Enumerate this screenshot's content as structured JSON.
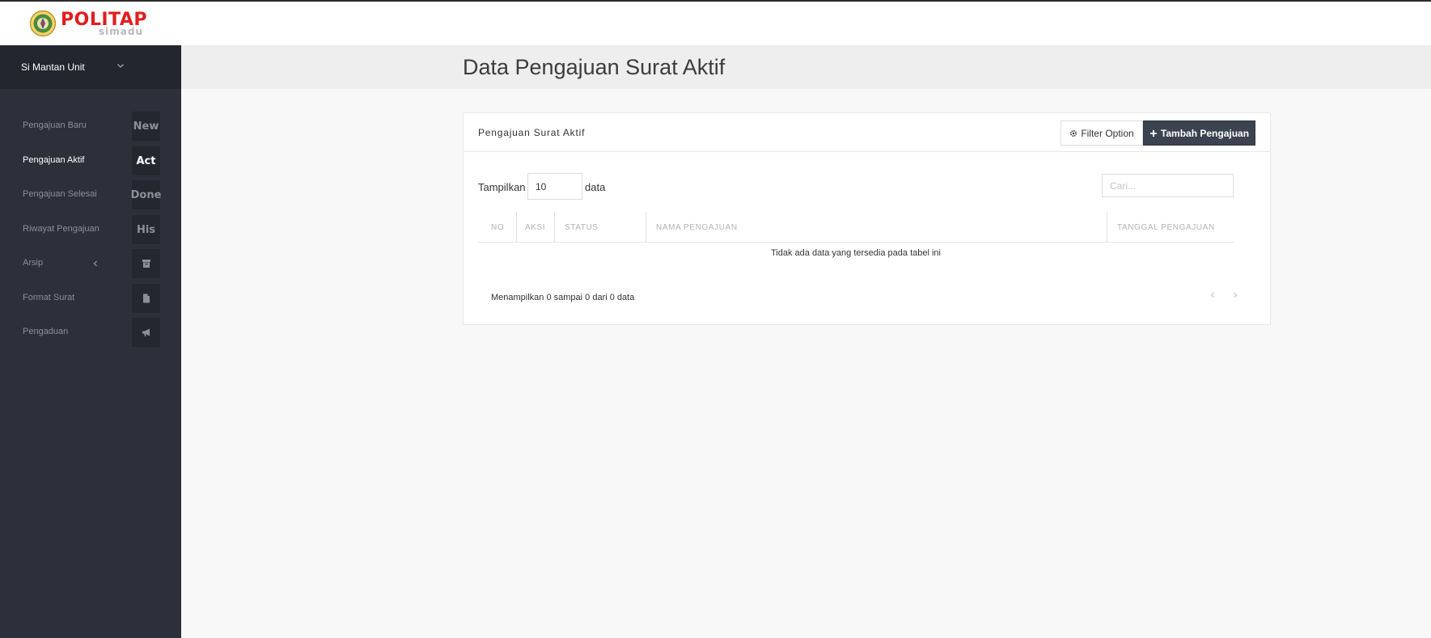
{
  "brand": {
    "name": "POLITAP",
    "sub": "simadu"
  },
  "sidebar": {
    "user": "Si Mantan Unit",
    "items": [
      {
        "label": "Pengajuan Baru",
        "badge": "New",
        "active": false
      },
      {
        "label": "Pengajuan Aktif",
        "badge": "Act",
        "active": true
      },
      {
        "label": "Pengajuan Selesai",
        "badge": "Done",
        "active": false
      },
      {
        "label": "Riwayat Pengajuan",
        "badge": "His",
        "active": false
      },
      {
        "label": "Arsip",
        "icon": "archive-icon",
        "active": false
      },
      {
        "label": "Format Surat",
        "icon": "file-icon",
        "active": false
      },
      {
        "label": "Pengaduan",
        "icon": "megaphone-icon",
        "active": false
      }
    ]
  },
  "page": {
    "title": "Data Pengajuan Surat Aktif"
  },
  "panel": {
    "title": "Pengajuan Surat Aktif",
    "filter_label": "Filter Option",
    "add_label": "Tambah Pengajuan",
    "length": {
      "prefix": "Tampilkan",
      "value": "10",
      "suffix": "data"
    },
    "search": {
      "placeholder": "Cari..."
    },
    "table": {
      "headers": [
        "NO",
        "AKSI",
        "STATUS",
        "NAMA PENGAJUAN",
        "TANGGAL PENGAJUAN"
      ],
      "empty": "Tidak ada data yang tersedia pada tabel ini"
    },
    "info": "Menampilkan 0 sampai 0 dari 0 data"
  },
  "colors": {
    "sidebar_bg": "#2b303b",
    "sidebar_header_bg": "#22262e",
    "brand_red": "#e21d1d",
    "primary_button": "#3b4350"
  }
}
